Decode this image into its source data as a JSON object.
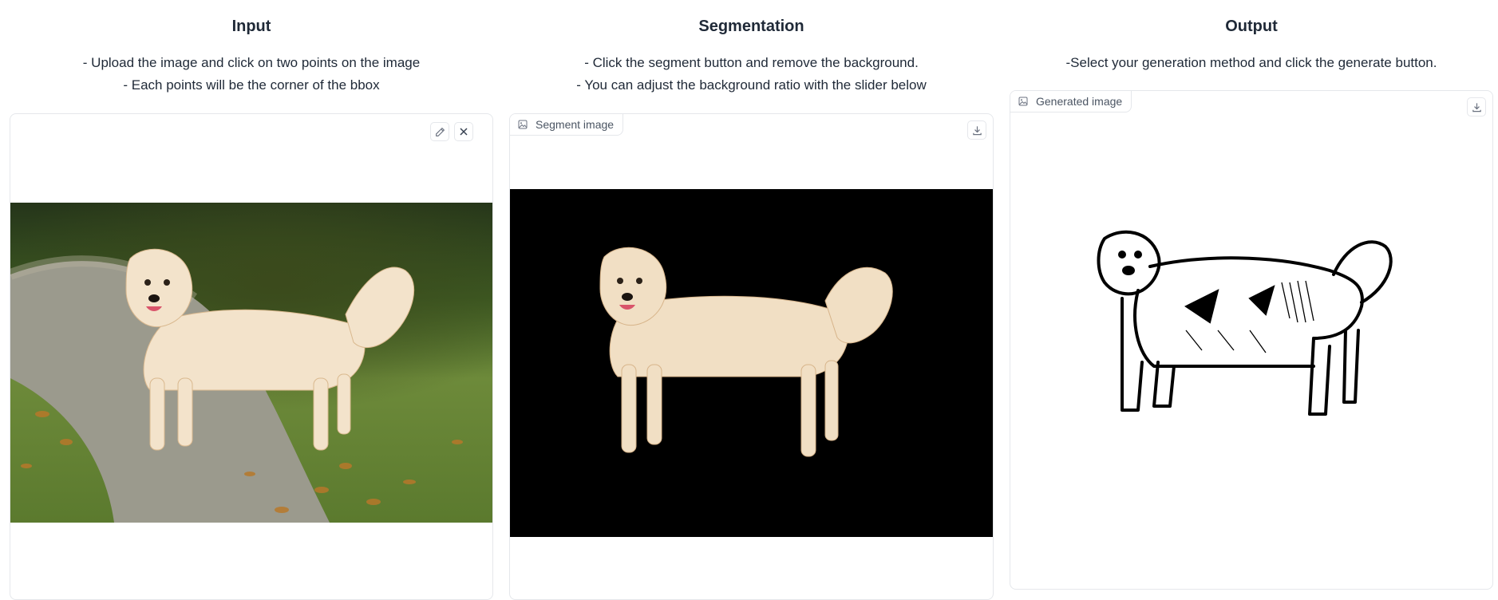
{
  "columns": {
    "input": {
      "title": "Input",
      "desc": [
        "- Upload the image and click on two points on the image",
        "- Each points will be the corner of the bbox"
      ],
      "tools": {
        "edit": "pencil-icon",
        "clear": "close-icon"
      }
    },
    "segmentation": {
      "title": "Segmentation",
      "desc": [
        "- Click the segment button and remove the background.",
        "- You can adjust the background ratio with the slider below"
      ],
      "label": "Segment image"
    },
    "output": {
      "title": "Output",
      "desc": [
        "-Select your generation method and click the generate button."
      ],
      "label": "Generated image"
    }
  },
  "colors": {
    "border": "#e5e7eb",
    "text": "#1f2937",
    "muted": "#4b5563"
  }
}
